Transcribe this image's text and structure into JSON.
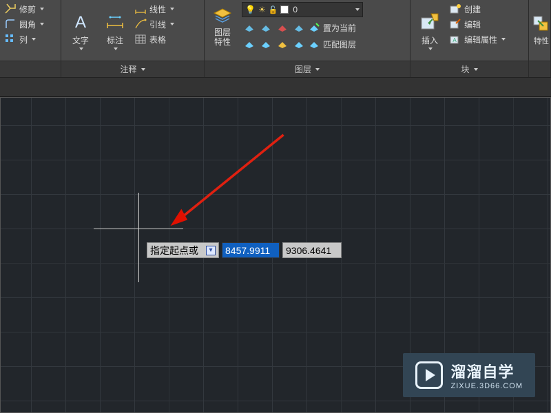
{
  "ribbon": {
    "p0": {
      "trim": "修剪",
      "fillet": "圆角",
      "array": "列"
    },
    "p1": {
      "text": "文字",
      "dim": "标注",
      "linetype": "线性",
      "leader": "引线",
      "table": "表格",
      "title": "注释"
    },
    "p2": {
      "setcurrent": "置为当前",
      "matchlayer": "匹配图层",
      "title": "图层",
      "props": "图层\n特性",
      "layer0": "0"
    },
    "p3": {
      "insert": "插入",
      "create": "创建",
      "edit": "编辑",
      "editattr": "编辑属性",
      "title": "块"
    },
    "p4": {
      "props": "特性"
    }
  },
  "dyn": {
    "prompt": "指定起点或",
    "x": "8457.9911",
    "y": "9306.4641"
  },
  "watermark": {
    "brand": "溜溜自学",
    "url": "ZIXUE.3D66.COM"
  }
}
